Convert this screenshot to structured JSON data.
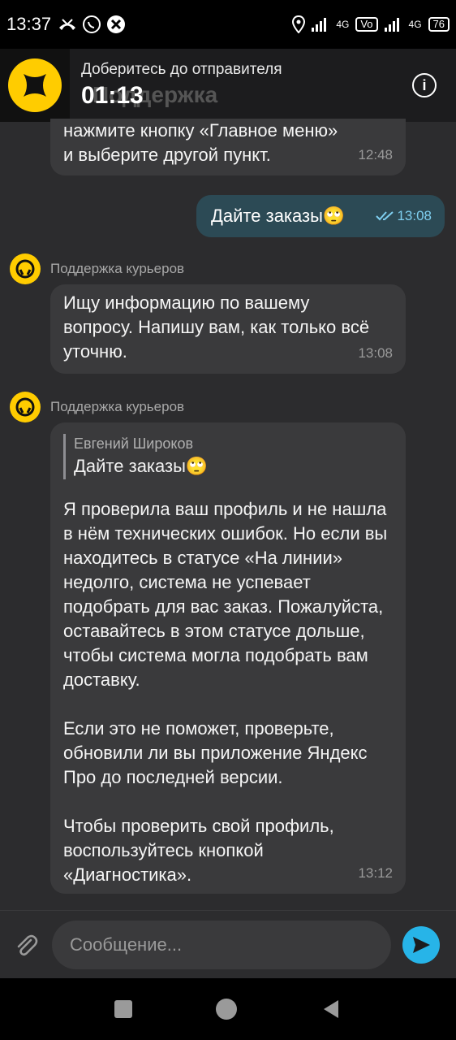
{
  "status_bar": {
    "time": "13:37",
    "network_1": "4G",
    "network_2": "4G",
    "battery": "76"
  },
  "banner": {
    "subtitle": "Доберитесь до отправителя",
    "timer": "01:13",
    "ghost_title": "Поддержка"
  },
  "messages": [
    {
      "type": "incoming_partial",
      "text_line_1": "нажмите кнопку «Главное меню»",
      "text_line_2": "и выберите другой пункт.",
      "time": "12:48"
    },
    {
      "type": "outgoing",
      "text": "Дайте заказы🙄",
      "time": "13:08"
    },
    {
      "type": "incoming",
      "sender": "Поддержка курьеров",
      "text": "Ищу информацию по вашему вопросу. Напишу вам, как только всё уточню.",
      "time": "13:08"
    },
    {
      "type": "incoming_reply",
      "sender": "Поддержка курьеров",
      "quote_author": "Евгений Широков",
      "quote_text": "Дайте заказы🙄",
      "paragraph_1": "Я проверила ваш профиль и не нашла в нём технических ошибок. Но если вы находитесь в статусе «На линии» недолго, система не успевает подобрать для вас заказ. Пожалуйста, оставайтесь в этом статусе дольше, чтобы система могла подобрать вам доставку.",
      "paragraph_2": "Если это не поможет, проверьте, обновили ли вы приложение Яндекс Про до последней версии.",
      "paragraph_3": "Чтобы проверить свой профиль, воспользуйтесь кнопкой «Диагностика».",
      "time": "13:12"
    }
  ],
  "input": {
    "placeholder": "Сообщение..."
  },
  "colors": {
    "accent": "#27b4e8",
    "brand": "#ffcc00",
    "bubble_out": "#2c4a55",
    "bubble_in": "#3a3a3c"
  }
}
